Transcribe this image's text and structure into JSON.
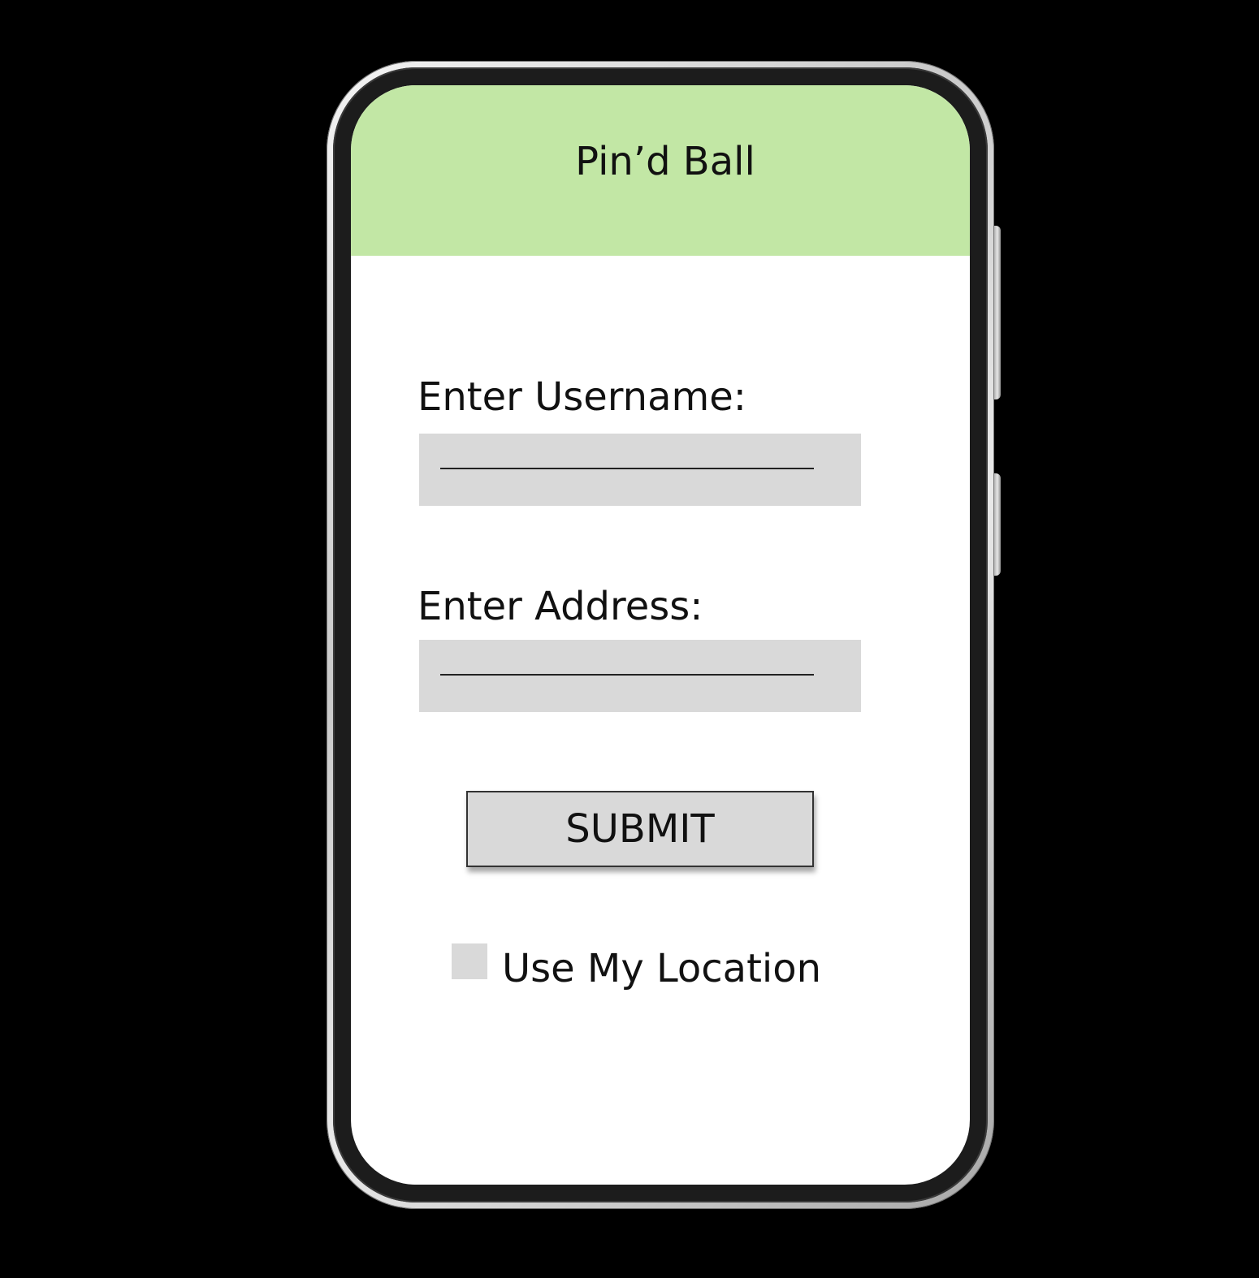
{
  "app": {
    "title": "Pin’d Ball"
  },
  "form": {
    "username_label": "Enter Username:",
    "username_value": "",
    "address_label": "Enter Address:",
    "address_value": "",
    "submit_label": "SUBMIT",
    "use_location_label": "Use My Location",
    "use_location_checked": false
  },
  "colors": {
    "header_bg": "#c2e7a5",
    "field_bg": "#d9d9d9",
    "screen_bg": "#ffffff",
    "background": "#000000"
  }
}
